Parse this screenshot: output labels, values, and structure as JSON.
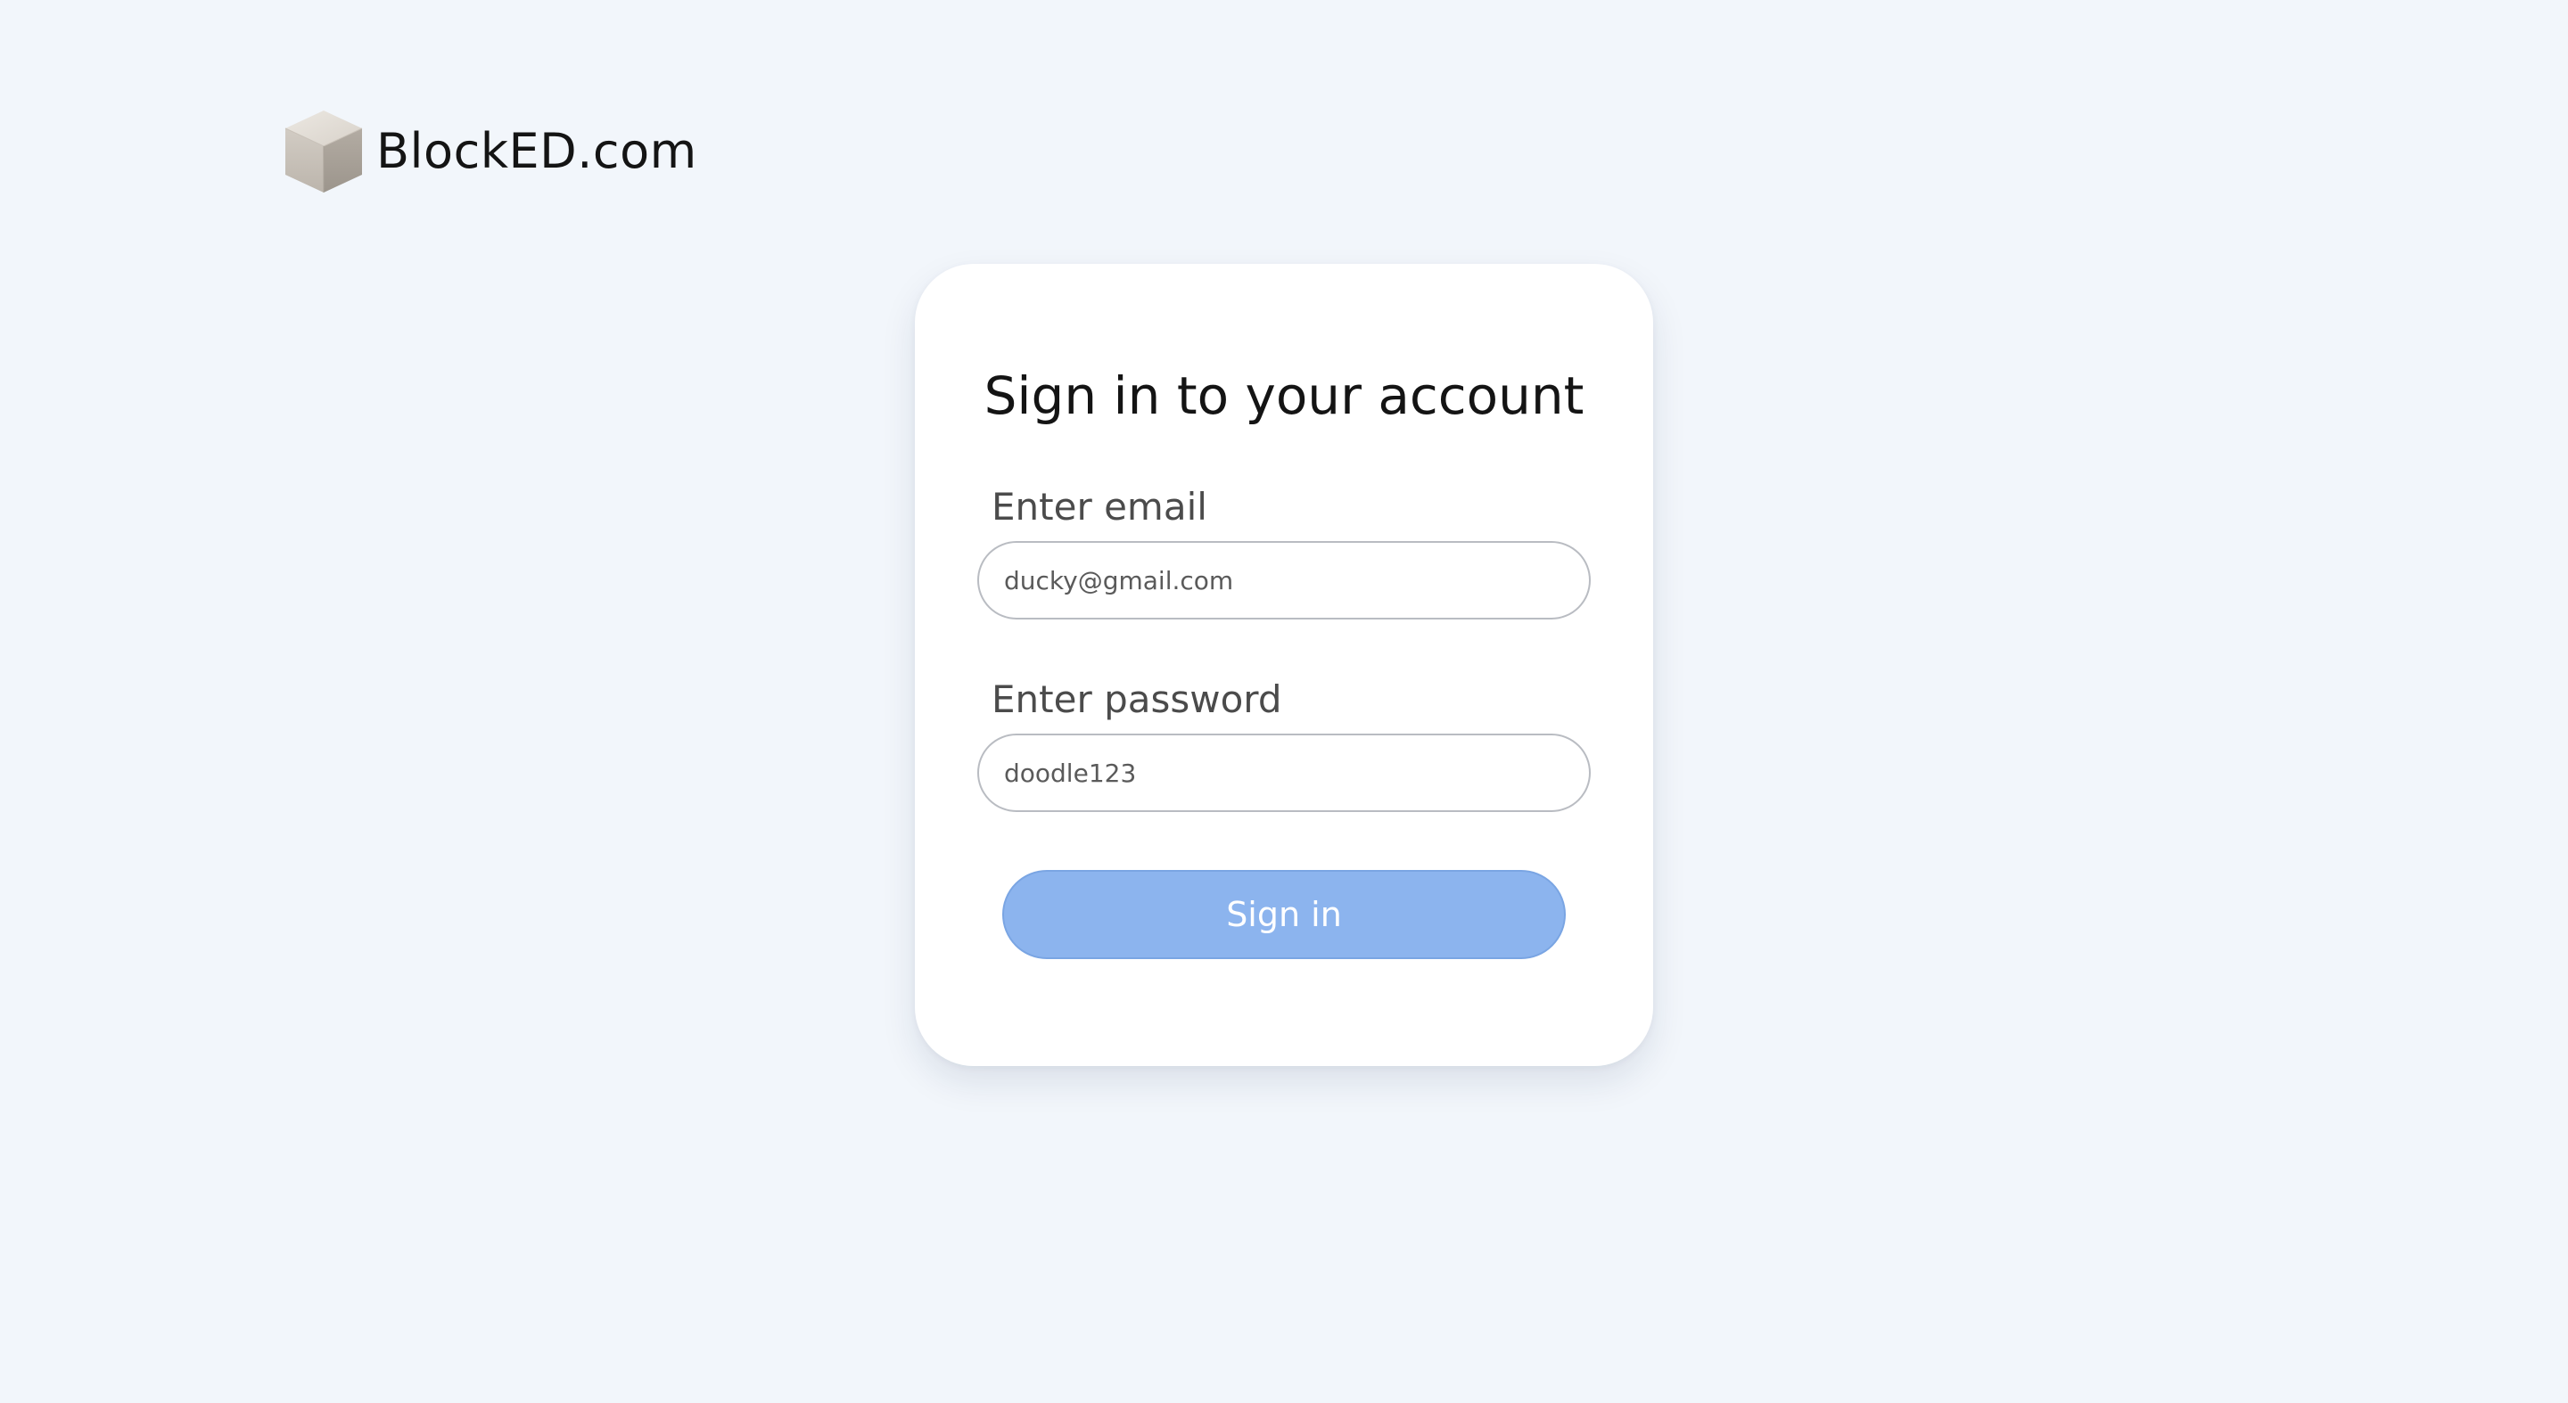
{
  "brand": {
    "name": "BlockED.com",
    "icon": "cube-logo-icon"
  },
  "signin": {
    "title": "Sign in to your account",
    "email_label": "Enter email",
    "email_value": "ducky@gmail.com",
    "password_label": "Enter password",
    "password_value": "doodle123",
    "button_label": "Sign in"
  },
  "colors": {
    "background": "#f2f6fb",
    "card": "#ffffff",
    "button": "#8cb4ee"
  }
}
